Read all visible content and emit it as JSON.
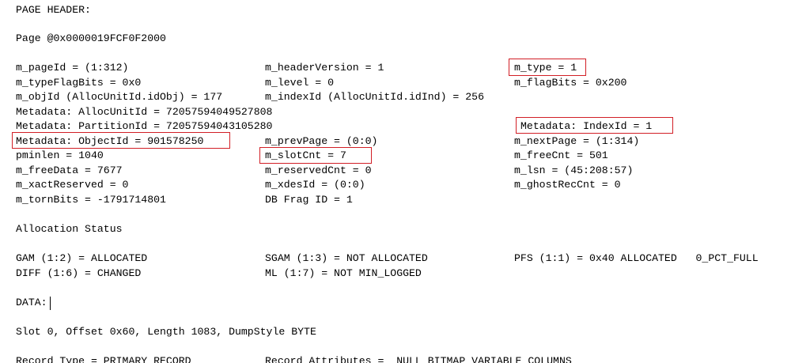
{
  "page_header": {
    "title": "PAGE HEADER:",
    "page_line": "Page @0x0000019FCF0F2000"
  },
  "header_rows": [
    [
      "m_pageId = (1:312)",
      "m_headerVersion = 1",
      "m_type = 1"
    ],
    [
      "m_typeFlagBits = 0x0",
      "m_level = 0",
      "m_flagBits = 0x200"
    ],
    [
      "m_objId (AllocUnitId.idObj) = 177",
      "m_indexId (AllocUnitId.idInd) = 256",
      ""
    ],
    [
      "Metadata: AllocUnitId = 72057594049527808",
      "",
      ""
    ],
    [
      "Metadata: PartitionId = 72057594043105280",
      "",
      "Metadata: IndexId = 1"
    ],
    [
      "Metadata: ObjectId = 901578250",
      "m_prevPage = (0:0)",
      "m_nextPage = (1:314)"
    ],
    [
      "pminlen = 1040",
      "m_slotCnt = 7",
      "m_freeCnt = 501"
    ],
    [
      "m_freeData = 7677",
      "m_reservedCnt = 0",
      "m_lsn = (45:208:57)"
    ],
    [
      "m_xactReserved = 0",
      "m_xdesId = (0:0)",
      "m_ghostRecCnt = 0"
    ],
    [
      "m_tornBits = -1791714801",
      "DB Frag ID = 1",
      ""
    ]
  ],
  "allocation": {
    "title": "Allocation Status",
    "rows": [
      [
        "GAM (1:2) = ALLOCATED",
        "SGAM (1:3) = NOT ALLOCATED",
        "PFS (1:1) = 0x40 ALLOCATED   0_PCT_FULL"
      ],
      [
        "DIFF (1:6) = CHANGED",
        "ML (1:7) = NOT MIN_LOGGED",
        ""
      ]
    ]
  },
  "data_section": {
    "title": "DATA:",
    "slot_line": "Slot 0, Offset 0x60, Length 1083, DumpStyle BYTE",
    "record_line_left": "Record Type = PRIMARY_RECORD",
    "record_line_right": "Record Attributes =  NULL_BITMAP VARIABLE_COLUMNS"
  },
  "highlight_color": "#d21f26"
}
